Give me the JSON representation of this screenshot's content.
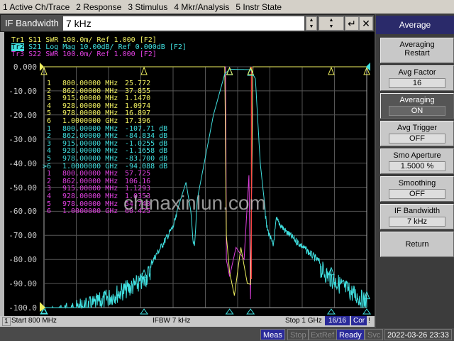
{
  "menu": [
    "1 Active Ch/Trace",
    "2 Response",
    "3 Stimulus",
    "4 Mkr/Analysis",
    "5 Instr State"
  ],
  "entry": {
    "label": "IF Bandwidth",
    "value": "7 kHz"
  },
  "traces": [
    {
      "label": "Tr1",
      "param": "S11",
      "format": "SWR",
      "scale": "100.0m/",
      "ref": "Ref 1.000",
      "tag": "[F2]",
      "color": "#f0f060"
    },
    {
      "label": "Tr2",
      "param": "S21",
      "format": "Log Mag",
      "scale": "10.00dB/",
      "ref": "Ref 0.000dB",
      "tag": "[F2]",
      "color": "#40e0e0",
      "active": true
    },
    {
      "label": "Tr3",
      "param": "S22",
      "format": "SWR",
      "scale": "100.0m/",
      "ref": "Ref 1.000",
      "tag": "[F2]",
      "color": "#e040e0"
    }
  ],
  "y_labels": [
    "0.000",
    "-10.00",
    "-20.00",
    "-30.00",
    "-40.00",
    "-50.00",
    "-60.00",
    "-70.00",
    "-80.00",
    "-90.00",
    "-100.0"
  ],
  "markers": {
    "tr1": [
      [
        "1",
        "800.00000 MHz",
        "25.772"
      ],
      [
        "2",
        "862.00000 MHz",
        "37.855"
      ],
      [
        "3",
        "915.00000 MHz",
        "1.1470"
      ],
      [
        "4",
        "928.00000 MHz",
        "1.0974"
      ],
      [
        "5",
        "978.00000 MHz",
        "16.897"
      ],
      [
        "6",
        "1.0000000 GHz",
        "17.396"
      ]
    ],
    "tr2": [
      [
        "1",
        "800.00000 MHz",
        "-107.71 dB"
      ],
      [
        "2",
        "862.00000 MHz",
        "-84.834 dB"
      ],
      [
        "3",
        "915.00000 MHz",
        "-1.0255 dB"
      ],
      [
        "4",
        "928.00000 MHz",
        "-1.1658 dB"
      ],
      [
        "5",
        "978.00000 MHz",
        "-83.700 dB"
      ],
      [
        ">6",
        "1.0000000 GHz",
        "-94.088 dB"
      ]
    ],
    "tr3": [
      [
        "1",
        "800.00000 MHz",
        "57.725"
      ],
      [
        "2",
        "862.00000 MHz",
        "106.16"
      ],
      [
        "3",
        "915.00000 MHz",
        "1.1293"
      ],
      [
        "4",
        "928.00000 MHz",
        "1.0353"
      ],
      [
        "5",
        "978.00000 MHz",
        "54.740"
      ],
      [
        "6",
        "1.0000000 GHz",
        "60.425"
      ]
    ]
  },
  "chart_data": {
    "type": "line",
    "xlim_mhz": [
      800,
      1000
    ],
    "ylim_db": [
      -100,
      0
    ],
    "grid": true,
    "series": [
      {
        "name": "S21",
        "unit": "dB",
        "points": [
          [
            800,
            -100
          ],
          [
            830,
            -95
          ],
          [
            862,
            -85
          ],
          [
            880,
            -65
          ],
          [
            888,
            -48
          ],
          [
            891,
            -60
          ],
          [
            893,
            -74
          ],
          [
            895,
            -55
          ],
          [
            905,
            -20
          ],
          [
            912,
            -3
          ],
          [
            915,
            -1
          ],
          [
            928,
            -1.2
          ],
          [
            931,
            -5
          ],
          [
            934,
            -40
          ],
          [
            938,
            -65
          ],
          [
            942,
            -73
          ],
          [
            944,
            -62
          ],
          [
            950,
            -67
          ],
          [
            978,
            -84
          ],
          [
            1000,
            -94
          ]
        ]
      },
      {
        "name": "S11",
        "unit": "SWR",
        "points": [
          [
            800,
            25.772
          ],
          [
            862,
            37.855
          ],
          [
            913,
            1.3
          ],
          [
            915,
            1.147
          ],
          [
            918,
            1.05
          ],
          [
            922,
            1.25
          ],
          [
            926,
            1.1
          ],
          [
            928,
            1.097
          ],
          [
            931,
            3
          ],
          [
            978,
            16.897
          ],
          [
            1000,
            17.396
          ]
        ]
      },
      {
        "name": "S22",
        "unit": "SWR",
        "points": [
          [
            800,
            57.725
          ],
          [
            862,
            106.16
          ],
          [
            913,
            1.2
          ],
          [
            915,
            1.129
          ],
          [
            919,
            1.25
          ],
          [
            924,
            1.2
          ],
          [
            927,
            1.55
          ],
          [
            928,
            1.035
          ],
          [
            931,
            3
          ],
          [
            978,
            54.74
          ],
          [
            1000,
            60.425
          ]
        ]
      }
    ]
  },
  "watermark": "chinaxinlun.com",
  "channel_status": {
    "channel": "1",
    "start": "Start 800 MHz",
    "ifbw": "IFBW 7 kHz",
    "stop": "Stop 1 GHz",
    "avg": "16/16",
    "cor": "Cor",
    "flag": "!"
  },
  "status_bar": {
    "meas": "Meas",
    "stop": "Stop",
    "extref": "ExtRef",
    "ready": "Ready",
    "svc": "Svc",
    "datetime": "2022-03-26 23:33"
  },
  "softkeys": {
    "title": "Average",
    "items": [
      {
        "label": "Averaging Restart"
      },
      {
        "label": "Avg Factor",
        "value": "16"
      },
      {
        "label": "Averaging",
        "value": "ON",
        "active": true
      },
      {
        "label": "Avg Trigger",
        "value": "OFF"
      },
      {
        "label": "Smo Aperture",
        "value": "1.5000  %"
      },
      {
        "label": "Smoothing",
        "value": "OFF"
      },
      {
        "label": "IF Bandwidth",
        "value": "7 kHz"
      },
      {
        "label": "Return"
      }
    ]
  }
}
